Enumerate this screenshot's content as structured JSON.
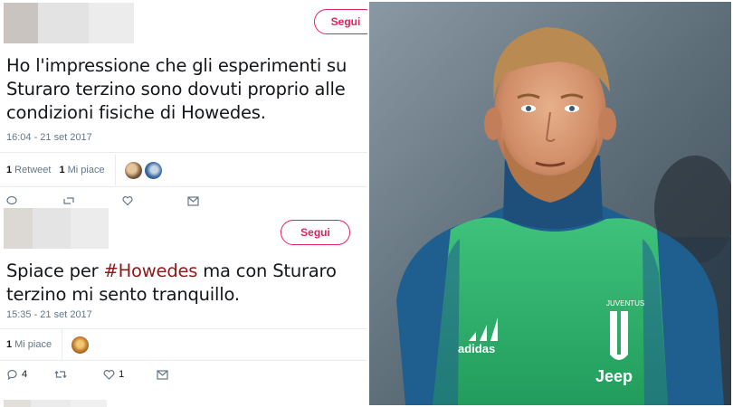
{
  "tweet1": {
    "follow_label": "Segui",
    "text": "Ho l'impressione che gli esperimenti su Sturaro terzino sono dovuti proprio alle condizioni fisiche di Howedes.",
    "timestamp": "16:04 - 21 set 2017",
    "retweet_count": "1",
    "retweet_label": "Retweet",
    "like_count": "1",
    "like_label": "Mi piace"
  },
  "tweet2": {
    "follow_label": "Segui",
    "text_before": "Spiace per ",
    "hashtag": "#Howedes",
    "text_after": " ma con Sturaro terzino mi sento tranquillo.",
    "timestamp": "15:35 - 21 set 2017",
    "like_count": "1",
    "like_label": "Mi piace",
    "reply_count": "4",
    "fav_count": "1"
  },
  "photo": {
    "jersey_logo": "JUVENTUS",
    "sponsor": "Jeep",
    "kit_brand": "adidas"
  },
  "colors": {
    "follow_accent": "#e0245e",
    "hashtag": "#8b1a1a",
    "meta_text": "#657786",
    "bib_green": "#2fb36d",
    "jacket_blue": "#1f5f8f"
  }
}
